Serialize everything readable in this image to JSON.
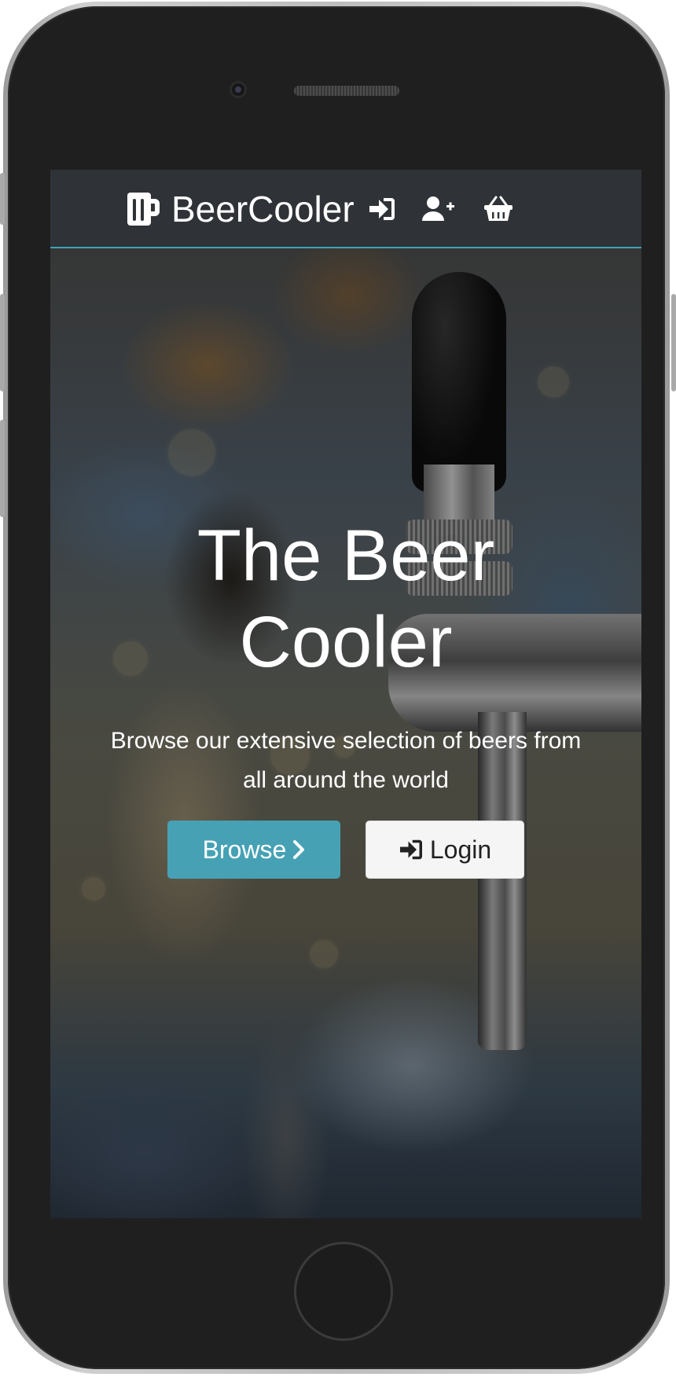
{
  "navbar": {
    "brand": "BeerCooler",
    "brand_icon": "beer-mug-icon",
    "icons": [
      "sign-in-icon",
      "user-plus-icon",
      "shopping-basket-icon"
    ],
    "accent_color": "#3fa3b3"
  },
  "hero": {
    "title": "The Beer Cooler",
    "subtitle": "Browse our extensive selection of beers from all around the world",
    "browse_label": "Browse",
    "browse_icon": "chevron-right-icon",
    "login_label": "Login",
    "login_icon": "sign-in-icon",
    "browse_color": "#46a1b5",
    "login_color": "#f5f5f5"
  }
}
